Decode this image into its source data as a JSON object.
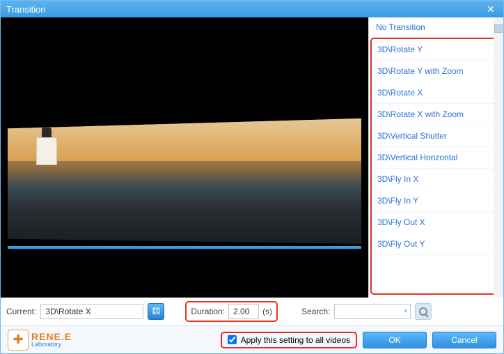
{
  "window": {
    "title": "Transition"
  },
  "sidebar": {
    "no_transition": "No Transition",
    "items": [
      "3D\\Rotate Y",
      "3D\\Rotate Y with Zoom",
      "3D\\Rotate X",
      "3D\\Rotate X with Zoom",
      "3D\\Vertical Shutter",
      "3D\\Vertical Horizontal",
      "3D\\Fly In X",
      "3D\\Fly In Y",
      "3D\\Fly Out X",
      "3D\\Fly Out Y"
    ]
  },
  "controls": {
    "current_label": "Current:",
    "current_value": "3D\\Rotate X",
    "duration_label": "Duration:",
    "duration_value": "2.00",
    "duration_unit": "(s)",
    "search_label": "Search:",
    "search_value": ""
  },
  "footer": {
    "apply_label": "Apply this setting to all videos",
    "apply_checked": true,
    "ok": "OK",
    "cancel": "Cancel",
    "logo_top": "RENE.E",
    "logo_bottom": "Laboratory"
  }
}
